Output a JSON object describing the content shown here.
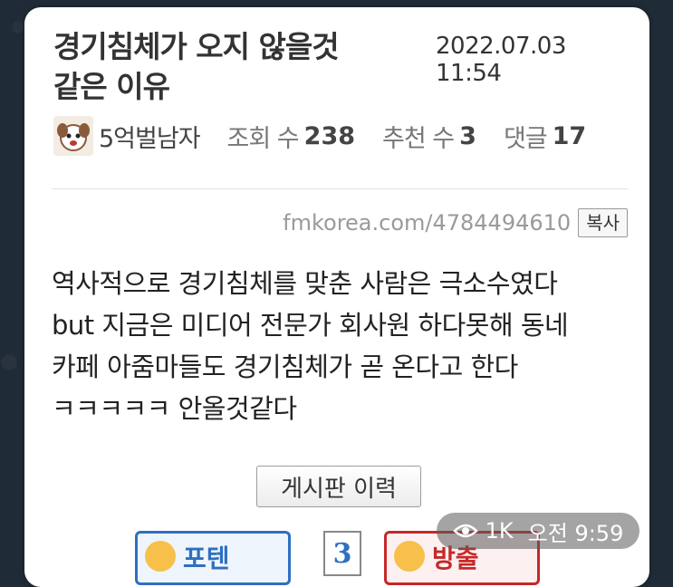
{
  "post": {
    "title": "경기침체가 오지 않을것\n같은 이유",
    "date": "2022.07.03 11:54",
    "author": "5억벌남자",
    "views_label": "조회 수",
    "views": "238",
    "recommends_label": "추천 수",
    "recommends": "3",
    "comments_label": "댓글",
    "comments": "17",
    "url": "fmkorea.com/4784494610",
    "copy_label": "복사",
    "body_lines": [
      "역사적으로 경기침체를 맞춘 사람은 극소수였다",
      "but 지금은 미디어 전문가 회사원 하다못해 동네",
      "카페 아줌마들도 경기침체가 곧 온다고 한다",
      "ㅋㅋㅋㅋㅋ 안올것같다"
    ],
    "board_history_label": "게시판 이력",
    "vote_up_label": "포텐",
    "vote_count": "3",
    "vote_down_label": "방출"
  },
  "overlay": {
    "views": "1K",
    "time": "오전 9:59"
  },
  "colors": {
    "background": "#1f2b36",
    "vote_up": "#2f6fc1",
    "vote_down": "#c62828"
  }
}
